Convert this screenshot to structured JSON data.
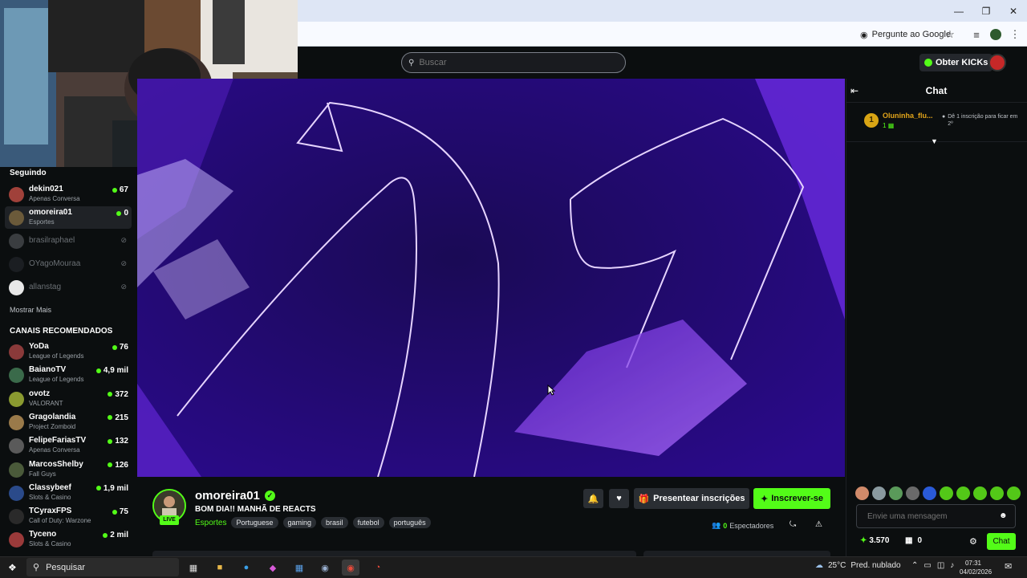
{
  "browser": {
    "ask_google": "Pergunte ao Google"
  },
  "header": {
    "search_placeholder": "Buscar",
    "get_kicks": "Obter KICKs"
  },
  "sidebar": {
    "following_title": "Seguindo",
    "following": [
      {
        "name": "dekin021",
        "category": "Apenas Conversa",
        "viewers": "67",
        "avatar_color": "#a0413a"
      },
      {
        "name": "omoreira01",
        "category": "Esportes",
        "viewers": "0",
        "avatar_color": "#6b5a3a"
      }
    ],
    "offline": [
      {
        "name": "brasilraphael",
        "avatar_color": "#3a3d40"
      },
      {
        "name": "OYagoMouraa",
        "avatar_color": "#1b1e22"
      },
      {
        "name": "allanstag",
        "avatar_color": "#e8e8e8"
      }
    ],
    "show_more": "Mostrar Mais",
    "recommended_title": "CANAIS RECOMENDADOS",
    "recommended": [
      {
        "name": "YoDa",
        "category": "League of Legends",
        "viewers": "76",
        "avatar_color": "#8a3a3a"
      },
      {
        "name": "BaianoTV",
        "category": "League of Legends",
        "viewers": "4,9 mil",
        "avatar_color": "#3a6a4a"
      },
      {
        "name": "ovotz",
        "category": "VALORANT",
        "viewers": "372",
        "avatar_color": "#8a9a30"
      },
      {
        "name": "Gragolandia",
        "category": "Project Zomboid",
        "viewers": "215",
        "avatar_color": "#9a7a4a"
      },
      {
        "name": "FelipeFariasTV",
        "category": "Apenas Conversa",
        "viewers": "132",
        "avatar_color": "#5a5a5a"
      },
      {
        "name": "MarcosShelby",
        "category": "Fall Guys",
        "viewers": "126",
        "avatar_color": "#4a5a3a"
      },
      {
        "name": "Classybeef",
        "category": "Slots & Casino",
        "viewers": "1,9 mil",
        "avatar_color": "#2a4a8a"
      },
      {
        "name": "TCyraxFPS",
        "category": "Call of Duty: Warzone",
        "viewers": "75",
        "avatar_color": "#2a2a2a"
      },
      {
        "name": "Tyceno",
        "category": "Slots & Casino",
        "viewers": "2 mil",
        "avatar_color": "#9a3a3a"
      }
    ]
  },
  "stream": {
    "name": "omoreira01",
    "live_label": "LIVE",
    "title": "BOM DIA!! MANHÃ DE REACTS",
    "category": "Esportes",
    "tags": [
      "Portuguese",
      "gaming",
      "brasil",
      "futebol",
      "português"
    ],
    "gift_label": "Presentear inscrições",
    "subscribe_label": "Inscrever-se",
    "viewers_count": "0",
    "viewers_label": "Espectadores"
  },
  "chat": {
    "title": "Chat",
    "leader_rank": "1",
    "leader_name": "Oluninha_flu...",
    "leader_count": "1",
    "leader_note": "Dê 1 inscrição para ficar em 2º",
    "message_placeholder": "Envie uma mensagem",
    "points": "3.570",
    "gifts": "0",
    "send_label": "Chat"
  },
  "taskbar": {
    "search_label": "Pesquisar",
    "temperature": "25°C",
    "weather": "Pred. nublado",
    "time": "07:31",
    "date": "04/02/2026"
  },
  "colors": {
    "accent": "#53fc18",
    "video_bg": "#200765"
  }
}
